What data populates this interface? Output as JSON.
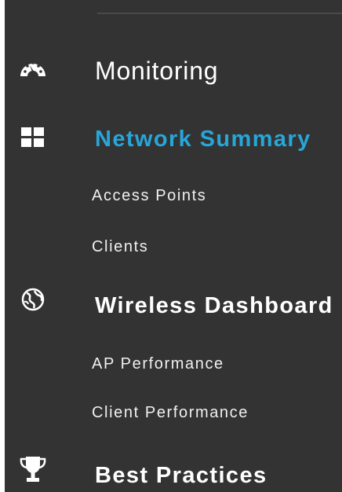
{
  "sidebar": {
    "accent_color": "#27a6d9",
    "background_color": "#333333",
    "sections": [
      {
        "label": "Monitoring",
        "icon": "dashboard-gauge-icon",
        "active": false
      },
      {
        "label": "Network Summary",
        "icon": "grid-icon",
        "active": true
      },
      {
        "label": "Wireless Dashboard",
        "icon": "globe-icon",
        "active": false
      },
      {
        "label": "Best Practices",
        "icon": "trophy-icon",
        "active": false
      }
    ],
    "subitems": {
      "network_summary": [
        {
          "label": "Access Points"
        },
        {
          "label": "Clients"
        }
      ],
      "wireless_dashboard": [
        {
          "label": "AP Performance"
        },
        {
          "label": "Client Performance"
        }
      ]
    }
  }
}
